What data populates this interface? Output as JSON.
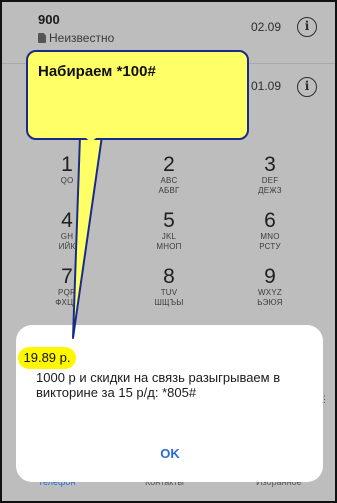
{
  "call_log": [
    {
      "name": "900",
      "sub": "Неизвестно",
      "date": "02.09",
      "info_icon": "info-icon"
    },
    {
      "name": "",
      "sub": "",
      "date": "01.09",
      "info_icon": "info-icon"
    }
  ],
  "dialpad": {
    "keys": [
      {
        "digit": "1",
        "line1": "QO",
        "line2": ""
      },
      {
        "digit": "2",
        "line1": "ABC",
        "line2": "АБВГ"
      },
      {
        "digit": "3",
        "line1": "DEF",
        "line2": "ДЕЖЗ"
      },
      {
        "digit": "4",
        "line1": "GH",
        "line2": "ИЙК"
      },
      {
        "digit": "5",
        "line1": "JKL",
        "line2": "МНОП"
      },
      {
        "digit": "6",
        "line1": "MNO",
        "line2": "РСТУ"
      },
      {
        "digit": "7",
        "line1": "PQR",
        "line2": "ФХЦЧ"
      },
      {
        "digit": "8",
        "line1": "TUV",
        "line2": "ШЩЪЫ"
      },
      {
        "digit": "9",
        "line1": "WXYZ",
        "line2": "ЬЭЮЯ"
      }
    ]
  },
  "dialog": {
    "price_badge": "19.89 р.",
    "message": "1000 р и скидки на связь разыгрываем в викторине за 15 р/д: *805#",
    "ok_label": "OK",
    "side_mark": "⋮"
  },
  "bottom_nav": {
    "phone": "Телефон",
    "contacts": "Контакты",
    "favorites": "Избранное"
  },
  "callout": {
    "text": "Набираем *100#",
    "fill_color": "#ffff66",
    "border_color": "#1a2a8a"
  }
}
